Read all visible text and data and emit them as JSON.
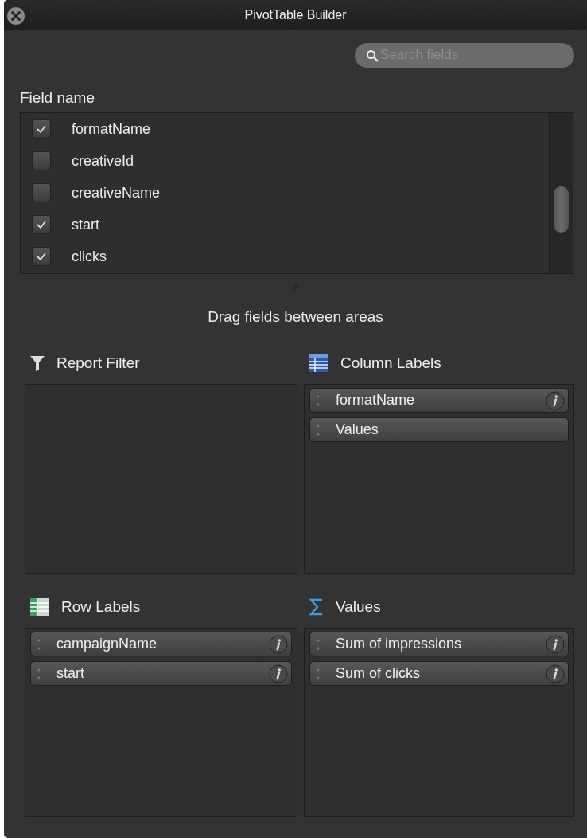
{
  "window": {
    "title": "PivotTable Builder"
  },
  "search": {
    "placeholder": "Search fields"
  },
  "field_list": {
    "heading": "Field name",
    "items": [
      {
        "label": "formatName",
        "checked": true
      },
      {
        "label": "creativeId",
        "checked": false
      },
      {
        "label": "creativeName",
        "checked": false
      },
      {
        "label": "start",
        "checked": true
      },
      {
        "label": "clicks",
        "checked": true
      }
    ]
  },
  "instruction": "Drag fields between areas",
  "areas": [
    {
      "kind": "filter",
      "title": "Report Filter"
    },
    {
      "kind": "columns",
      "title": "Column Labels",
      "items": [
        {
          "label": "formatName",
          "info": true
        },
        {
          "label": "Values",
          "info": false
        }
      ]
    },
    {
      "kind": "rows",
      "title": "Row Labels",
      "items": [
        {
          "label": "campaignName",
          "info": true
        },
        {
          "label": "start",
          "info": true
        }
      ]
    },
    {
      "kind": "values",
      "title": "Values",
      "items": [
        {
          "label": "Sum of impressions",
          "info": true
        },
        {
          "label": "Sum of clicks",
          "info": true
        }
      ]
    }
  ]
}
